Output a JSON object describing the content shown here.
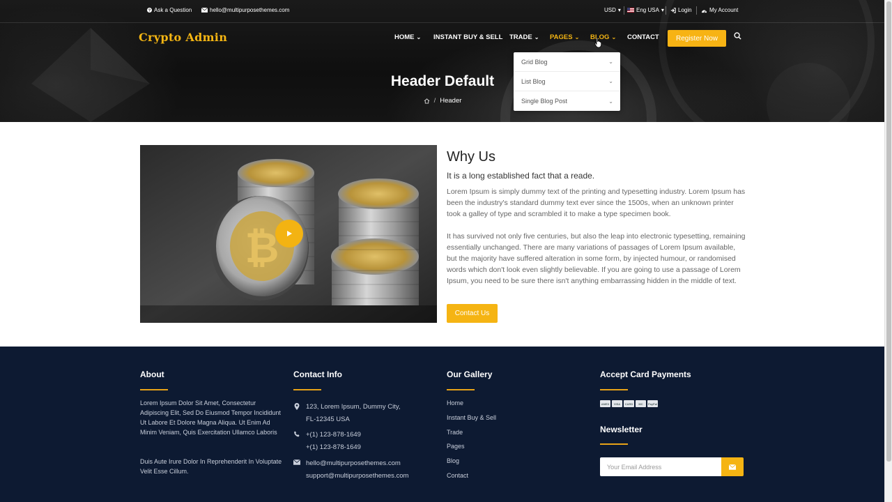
{
  "topbar": {
    "ask_question": "Ask a Question",
    "email": "hello@multipurposethemes.com",
    "currency": "USD",
    "language": "Eng USA",
    "login": "Login",
    "my_account": "My Account"
  },
  "brand": "Crypto Admin",
  "nav": {
    "home": "HOME",
    "instant": "INSTANT BUY & SELL",
    "trade": "TRADE",
    "pages": "PAGES",
    "blog": "BLOG",
    "contact": "CONTACT",
    "register": "Register Now"
  },
  "blog_dropdown": {
    "items": [
      {
        "label": "Grid Blog"
      },
      {
        "label": "List Blog"
      },
      {
        "label": "Single Blog Post"
      }
    ]
  },
  "hero": {
    "title": "Header Default",
    "breadcrumb_current": "Header"
  },
  "why": {
    "title": "Why Us",
    "subtitle": "It is a long established fact that a reade.",
    "para1": "Lorem Ipsum is simply dummy text of the printing and typesetting industry. Lorem Ipsum has been the industry's standard dummy text ever since the 1500s, when an unknown printer took a galley of type and scrambled it to make a type specimen book.",
    "para2": "It has survived not only five centuries, but also the leap into electronic typesetting, remaining essentially unchanged. There are many variations of passages of Lorem Ipsum available, but the majority have suffered alteration in some form, by injected humour, or randomised words which don't look even slightly believable. If you are going to use a passage of Lorem Ipsum, you need to be sure there isn't anything embarrassing hidden in the middle of text.",
    "button": "Contact Us"
  },
  "footer": {
    "about": {
      "title": "About",
      "text1": "Lorem Ipsum Dolor Sit Amet, Consectetur Adipiscing Elit, Sed Do Eiusmod Tempor Incididunt Ut Labore Et Dolore Magna Aliqua. Ut Enim Ad Minim Veniam, Quis Exercitation Ullamco Laboris",
      "text2": "Duis Aute Irure Dolor In Reprehenderit In Voluptate Velit Esse Cillum."
    },
    "contact": {
      "title": "Contact Info",
      "address_line1": "123, Lorem Ipsum, Dummy City,",
      "address_line2": "FL-12345 USA",
      "phone1": "+(1) 123-878-1649",
      "phone2": "+(1) 123-878-1649",
      "email1": "hello@multipurposethemes.com",
      "email2": "support@multipurposethemes.com"
    },
    "gallery": {
      "title": "Our Gallery",
      "links": [
        "Home",
        "Instant Buy & Sell",
        "Trade",
        "Pages",
        "Blog",
        "Contact"
      ]
    },
    "payments": {
      "title": "Accept Card Payments",
      "cards": [
        "AMEX",
        "VISA",
        "CARD",
        "MC",
        "PayPal"
      ]
    },
    "newsletter": {
      "title": "Newsletter",
      "placeholder": "Your Email Address"
    }
  },
  "colors": {
    "accent": "#f4b513",
    "footer_bg": "#0d1a32"
  }
}
